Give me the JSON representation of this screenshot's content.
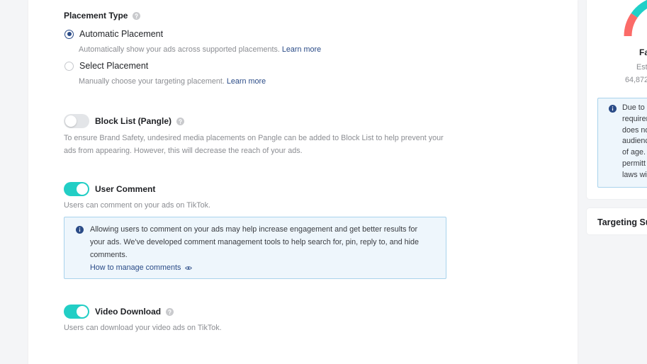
{
  "placement": {
    "title": "Placement Type",
    "options": [
      {
        "label": "Automatic Placement",
        "description": "Automatically show your ads across supported placements.",
        "link": "Learn more",
        "selected": true
      },
      {
        "label": "Select Placement",
        "description": "Manually choose your targeting placement.",
        "link": "Learn more",
        "selected": false
      }
    ]
  },
  "block_list": {
    "title": "Block List (Pangle)",
    "enabled": false,
    "description": "To ensure Brand Safety, undesired media placements on Pangle can be added to Block List to help prevent your ads from appearing. However, this will decrease the reach of your ads."
  },
  "user_comment": {
    "title": "User Comment",
    "enabled": true,
    "description": "Users can comment on your ads on TikTok.",
    "notice": {
      "text": "Allowing users to comment on your ads may help increase engagement and get better results for your ads. We've developed comment management tools to help search for, pin, reply to, and hide comments.",
      "link": "How to manage comments"
    }
  },
  "video_download": {
    "title": "Video Download",
    "enabled": true,
    "description": "Users can download your video ads on TikTok."
  },
  "audience_card": {
    "status": "Fa",
    "estimate_label": "Est",
    "estimate_value": "64,872",
    "notice_lines": [
      "Due to",
      "requirem",
      "does no",
      "audienc",
      "of age.",
      "permitt",
      "laws wil"
    ]
  },
  "targeting_summary": {
    "title": "Targeting Su"
  },
  "icons": {
    "help": "help-icon",
    "info": "info-icon",
    "eye": "eye-icon"
  },
  "colors": {
    "accent": "#2a4b87",
    "toggle_on": "#22cec5",
    "notice_bg": "#eef6fc",
    "notice_border": "#a9d3ec",
    "gauge_low": "#fb6b68",
    "gauge_high": "#20d0c8"
  }
}
